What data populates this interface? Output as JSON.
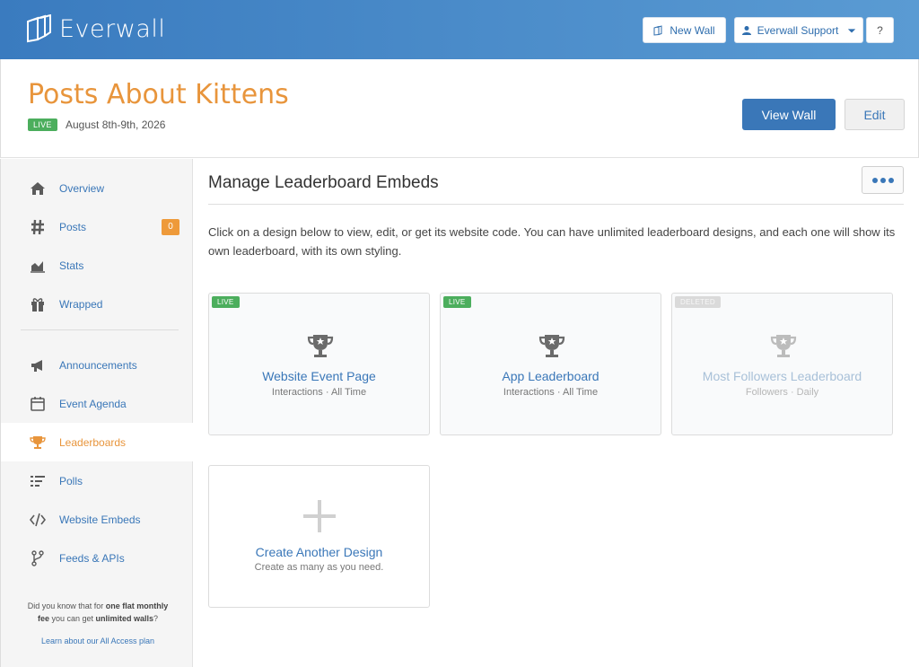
{
  "brand": {
    "name": "Everwall"
  },
  "topbar": {
    "new_wall_label": "New Wall",
    "support_label": "Everwall Support",
    "help_label": "?"
  },
  "header": {
    "title": "Posts About Kittens",
    "status_badge": "LIVE",
    "date": "August 8th-9th, 2026",
    "view_wall_label": "View Wall",
    "edit_label": "Edit"
  },
  "sidebar": {
    "items": [
      {
        "label": "Overview",
        "icon": "home-icon"
      },
      {
        "label": "Posts",
        "icon": "hash-icon",
        "count": "0"
      },
      {
        "label": "Stats",
        "icon": "chart-icon"
      },
      {
        "label": "Wrapped",
        "icon": "gift-icon"
      },
      {
        "label": "Announcements",
        "icon": "megaphone-icon"
      },
      {
        "label": "Event Agenda",
        "icon": "calendar-icon"
      },
      {
        "label": "Leaderboards",
        "icon": "trophy-icon",
        "active": true
      },
      {
        "label": "Polls",
        "icon": "list-icon"
      },
      {
        "label": "Website Embeds",
        "icon": "code-icon"
      },
      {
        "label": "Feeds & APIs",
        "icon": "fork-icon"
      }
    ],
    "promo": {
      "line1_pre": "Did you know that for ",
      "line1_bold": "one flat monthly",
      "line2_bold_pre": "fee",
      "line2_mid": " you can get ",
      "line2_bold": "unlimited walls",
      "line2_end": "?",
      "link": "Learn about our All Access plan"
    }
  },
  "main": {
    "title": "Manage Leaderboard Embeds",
    "description": "Click on a design below to view, edit, or get its website code. You can have unlimited leaderboard designs, and each one will show its own leaderboard, with its own styling.",
    "cards": [
      {
        "tag": "LIVE",
        "name": "Website Event Page",
        "subtitle": "Interactions · All Time"
      },
      {
        "tag": "LIVE",
        "name": "App Leaderboard",
        "subtitle": "Interactions · All Time"
      },
      {
        "tag": "DELETED",
        "name": "Most Followers Leaderboard",
        "subtitle": "Followers · Daily"
      }
    ],
    "create": {
      "name": "Create Another Design",
      "subtitle": "Create as many as you need."
    }
  },
  "colors": {
    "accent": "#3a77b8",
    "brand_orange": "#e8953c",
    "live_green": "#4cae5d",
    "topbar": "#4a8bc8"
  }
}
